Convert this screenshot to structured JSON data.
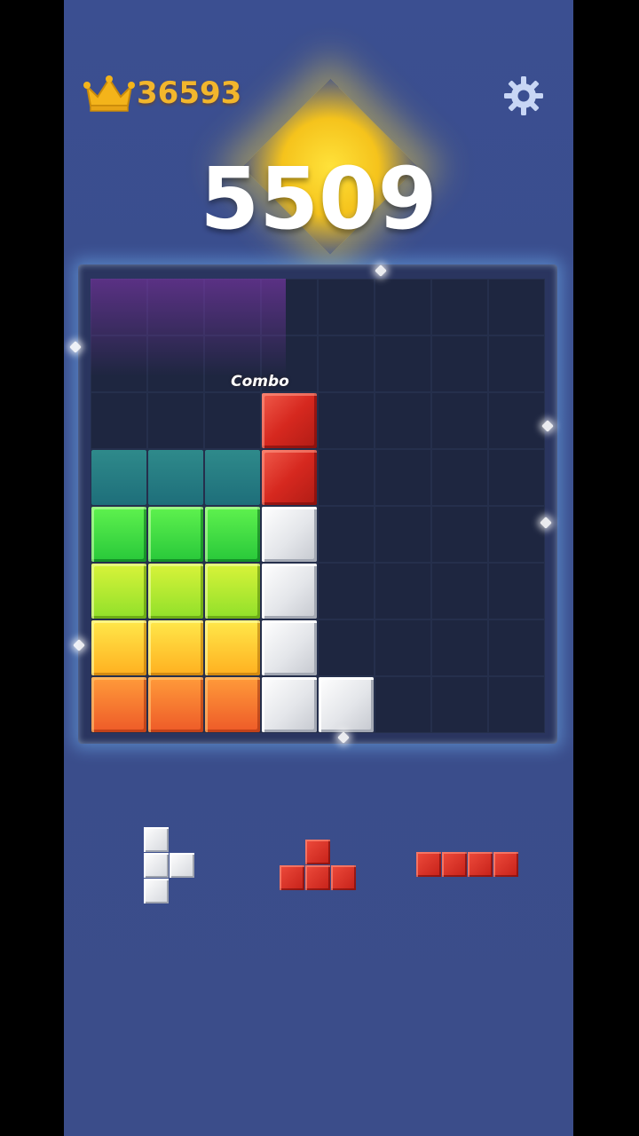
{
  "best_score": "36593",
  "current_score": "5509",
  "combo_label": "Combo",
  "colors": {
    "background": "#3b4f91",
    "gold": "#f2b62c",
    "board": "#1f2740"
  },
  "board": {
    "cols": 8,
    "rows": 8,
    "blocks": [
      {
        "col": 3,
        "row": 2,
        "color": "red"
      },
      {
        "col": 3,
        "row": 3,
        "color": "red"
      },
      {
        "col": 3,
        "row": 4,
        "color": "white"
      },
      {
        "col": 3,
        "row": 5,
        "color": "white"
      },
      {
        "col": 3,
        "row": 6,
        "color": "white"
      },
      {
        "col": 3,
        "row": 7,
        "color": "white"
      },
      {
        "col": 4,
        "row": 7,
        "color": "white"
      },
      {
        "col": 0,
        "row": 3,
        "color": "teal"
      },
      {
        "col": 1,
        "row": 3,
        "color": "teal"
      },
      {
        "col": 2,
        "row": 3,
        "color": "teal"
      },
      {
        "col": 0,
        "row": 4,
        "color": "green"
      },
      {
        "col": 1,
        "row": 4,
        "color": "green"
      },
      {
        "col": 2,
        "row": 4,
        "color": "green"
      },
      {
        "col": 0,
        "row": 5,
        "color": "lime"
      },
      {
        "col": 1,
        "row": 5,
        "color": "lime"
      },
      {
        "col": 2,
        "row": 5,
        "color": "lime"
      },
      {
        "col": 0,
        "row": 6,
        "color": "yellow"
      },
      {
        "col": 1,
        "row": 6,
        "color": "yellow"
      },
      {
        "col": 2,
        "row": 6,
        "color": "yellow"
      },
      {
        "col": 0,
        "row": 7,
        "color": "orange"
      },
      {
        "col": 1,
        "row": 7,
        "color": "orange"
      },
      {
        "col": 2,
        "row": 7,
        "color": "orange"
      }
    ]
  },
  "pieces": [
    {
      "name": "piece-1",
      "color": "white",
      "cells": [
        [
          0,
          0
        ],
        [
          0,
          1
        ],
        [
          1,
          1
        ],
        [
          0,
          2
        ]
      ]
    },
    {
      "name": "piece-2",
      "color": "red",
      "cells": [
        [
          1,
          0
        ],
        [
          0,
          1
        ],
        [
          1,
          1
        ],
        [
          2,
          1
        ]
      ]
    },
    {
      "name": "piece-3",
      "color": "red",
      "cells": [
        [
          0,
          0
        ],
        [
          1,
          0
        ],
        [
          2,
          0
        ],
        [
          3,
          0
        ]
      ]
    }
  ]
}
